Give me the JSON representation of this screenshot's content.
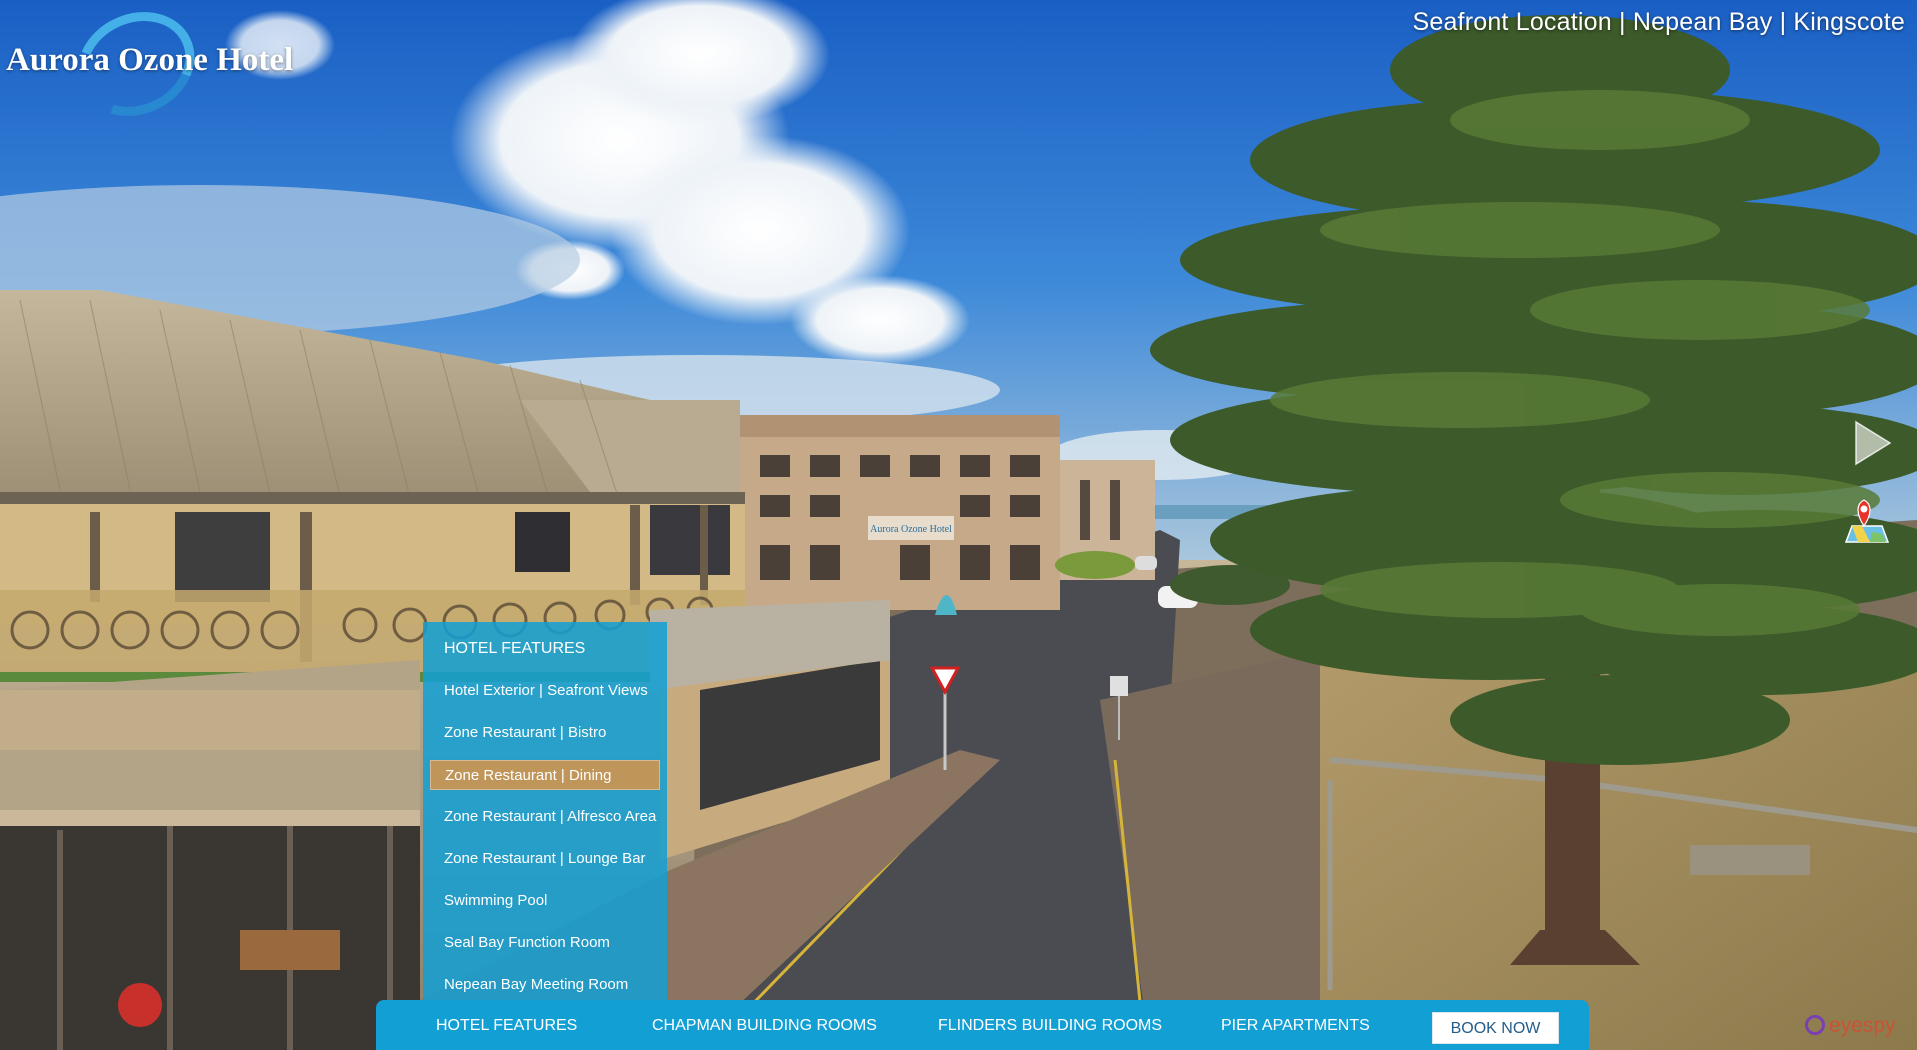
{
  "hotel": {
    "logo_name": "Aurora Ozone Hotel",
    "tagline": "Seafront Location | Nepean Bay | Kingscote",
    "building_sign": "Aurora Ozone Hotel"
  },
  "controls": {
    "next_icon": "chevron-right-icon",
    "map_icon": "map-pin-icon"
  },
  "dropdown": {
    "header": "HOTEL FEATURES",
    "items": [
      {
        "label": "Hotel Exterior | Seafront Views",
        "active": false
      },
      {
        "label": "Zone Restaurant | Bistro",
        "active": false
      },
      {
        "label": "Zone Restaurant | Dining",
        "active": true
      },
      {
        "label": "Zone Restaurant | Alfresco Area",
        "active": false
      },
      {
        "label": "Zone Restaurant | Lounge Bar",
        "active": false
      },
      {
        "label": "Swimming Pool",
        "active": false
      },
      {
        "label": "Seal Bay Function Room",
        "active": false
      },
      {
        "label": "Nepean Bay Meeting Room",
        "active": false
      }
    ]
  },
  "bottombar": {
    "items": [
      "HOTEL FEATURES",
      "CHAPMAN BUILDING ROOMS",
      "FLINDERS BUILDING ROOMS",
      "PIER APARTMENTS"
    ],
    "book_label": "BOOK NOW"
  },
  "credit": {
    "brand": "eyespy"
  },
  "colors": {
    "accent": "#12a0d4",
    "active_item": "#c0955a",
    "book_text": "#245d89"
  }
}
